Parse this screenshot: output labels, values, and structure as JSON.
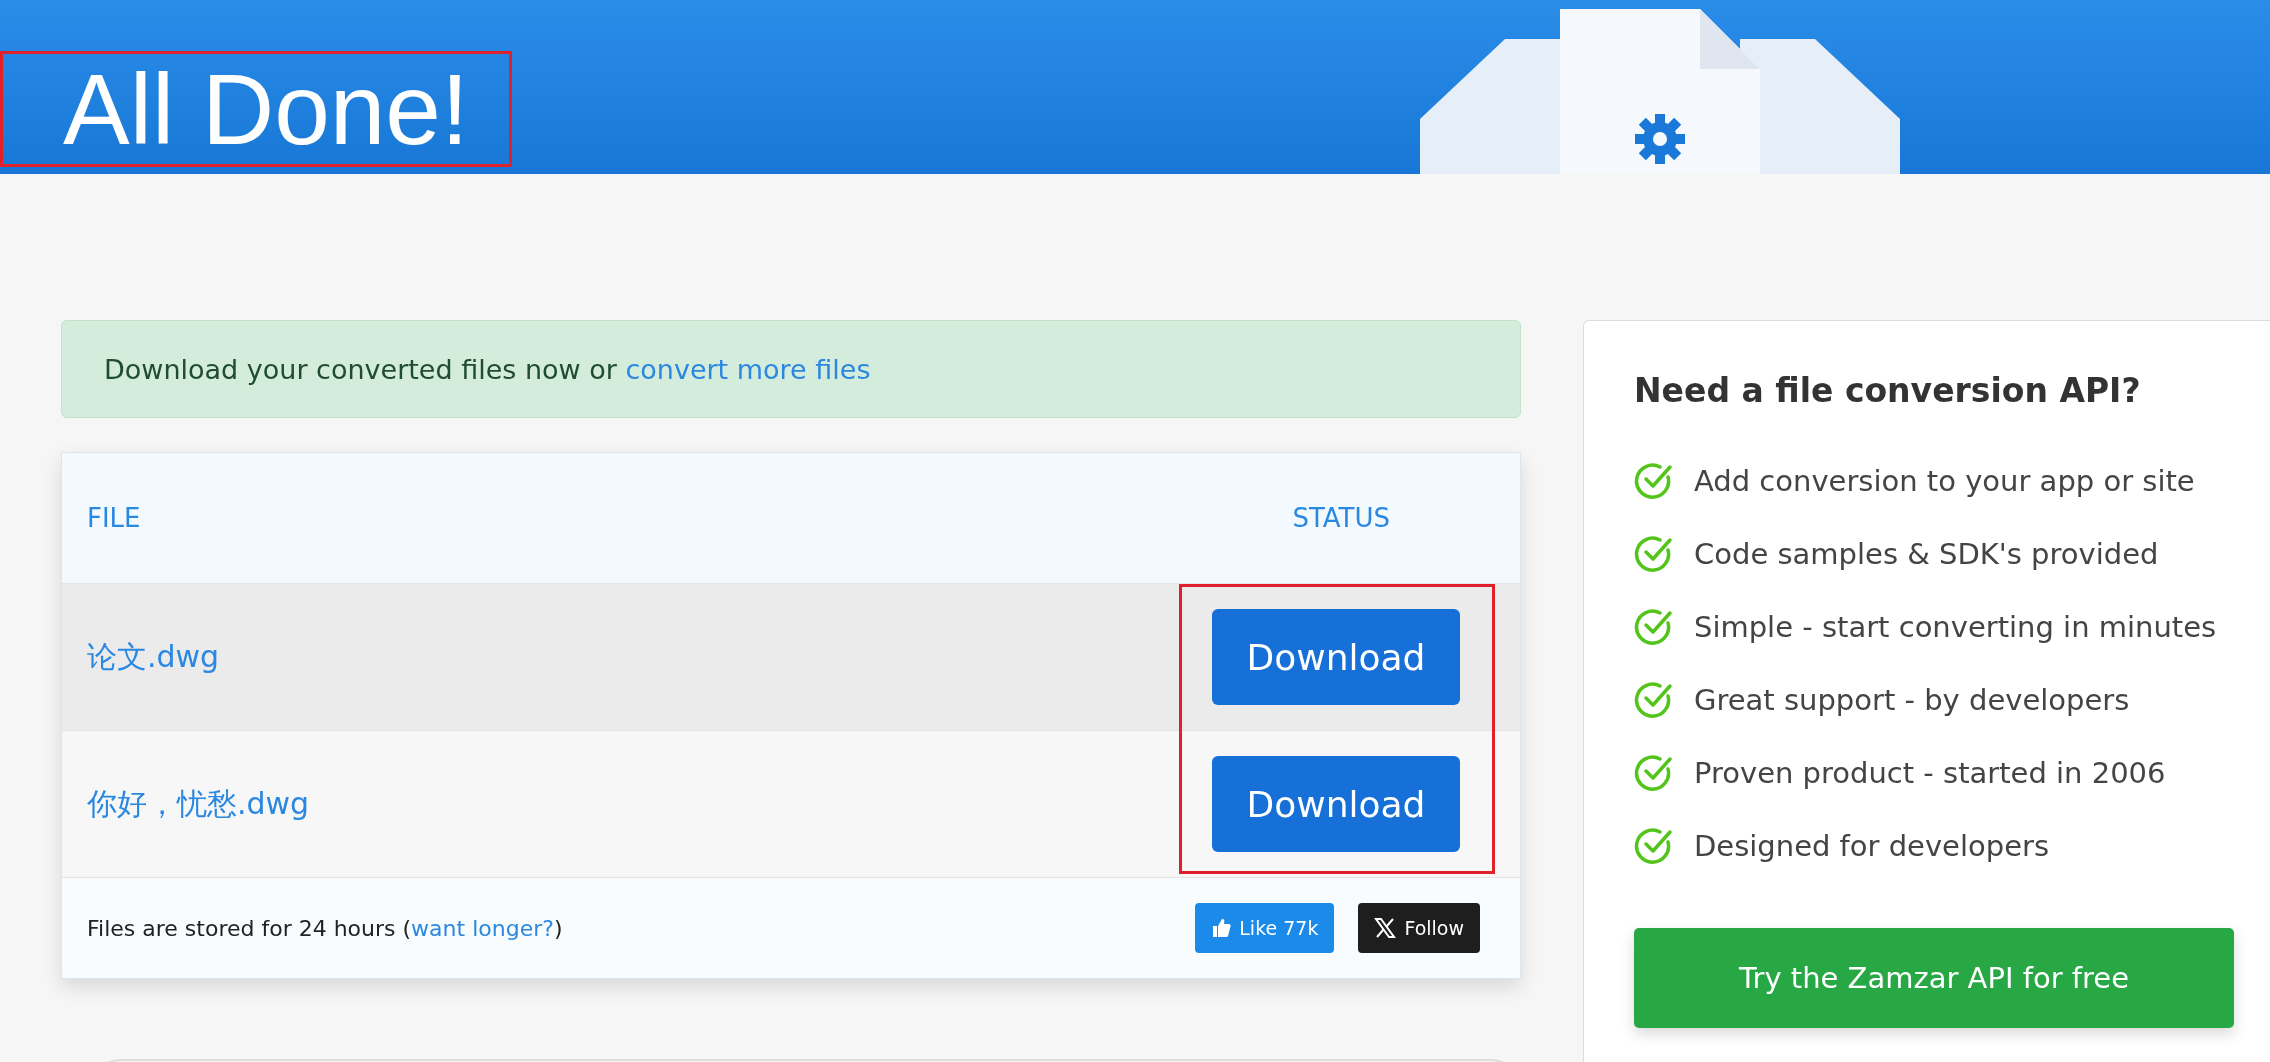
{
  "header": {
    "title": "All Done!"
  },
  "alert": {
    "text": "Download your converted files now or ",
    "link": "convert more files"
  },
  "table": {
    "columns": [
      "FILE",
      "STATUS"
    ],
    "rows": [
      {
        "file": "论文.dwg",
        "action": "Download",
        "selected": true
      },
      {
        "file": "你好，忧愁.dwg",
        "action": "Download",
        "selected": false
      }
    ],
    "footer": {
      "text": "Files are stored for 24 hours (",
      "link": "want longer?",
      "after": ")",
      "like": "Like 77k",
      "follow": "Follow"
    }
  },
  "sidebar": {
    "title": "Need a file conversion API?",
    "items": [
      "Add conversion to your app or site",
      "Code samples & SDK's provided",
      "Simple - start converting in minutes",
      "Great support - by developers",
      "Proven product - started in 2006",
      "Designed for developers"
    ],
    "button": "Try the Zamzar API for free"
  }
}
